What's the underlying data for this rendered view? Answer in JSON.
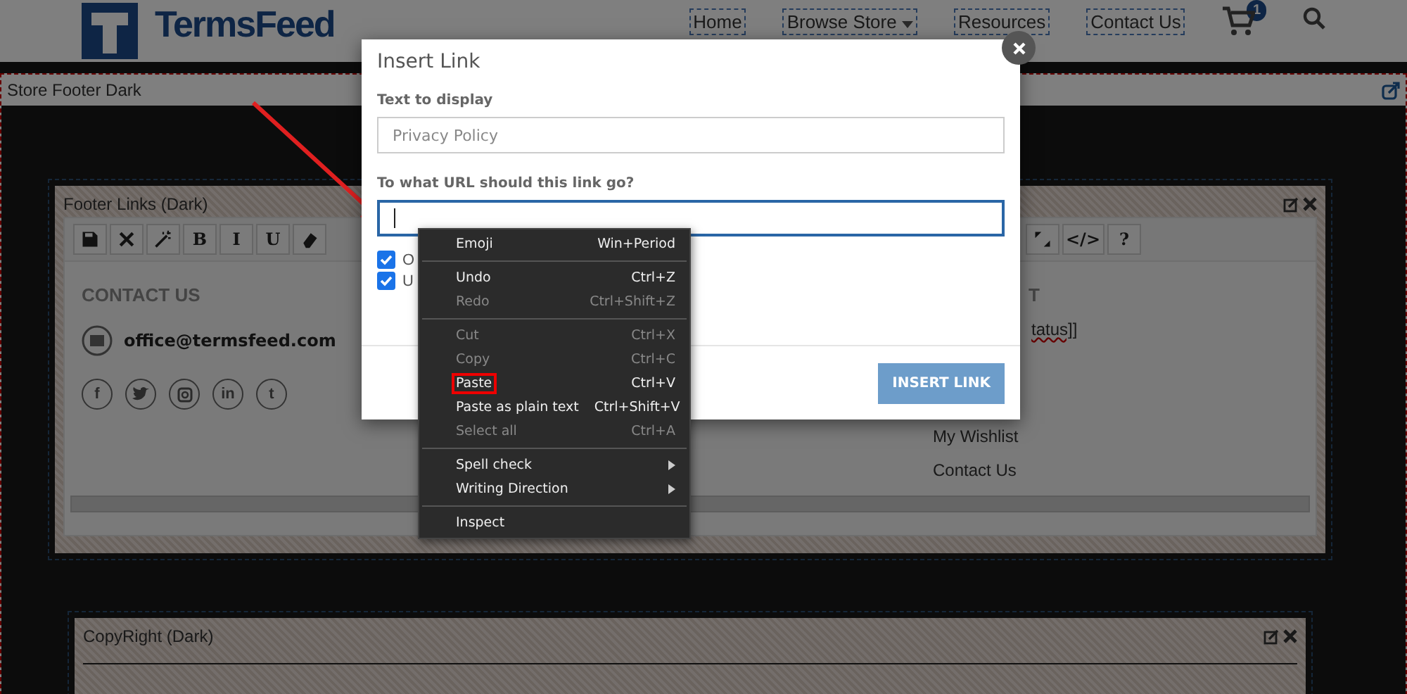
{
  "header": {
    "logo": "TermsFeed",
    "nav": [
      {
        "label": "Home",
        "dropdown": false
      },
      {
        "label": "Browse Store",
        "dropdown": true
      },
      {
        "label": "Resources",
        "dropdown": false
      },
      {
        "label": "Contact Us",
        "dropdown": false
      }
    ],
    "cart_count": "1"
  },
  "section": {
    "title": "Store Footer Dark"
  },
  "footer_links": {
    "title": "Footer Links (Dark)",
    "toolbar": [
      {
        "kind": "save"
      },
      {
        "kind": "close"
      },
      {
        "kind": "magic"
      },
      {
        "kind": "text",
        "label": "B"
      },
      {
        "kind": "text",
        "label": "I"
      },
      {
        "kind": "text",
        "label": "U"
      },
      {
        "kind": "eraser"
      }
    ],
    "toolbar_right": [
      {
        "kind": "expand"
      },
      {
        "kind": "text",
        "label": "</>"
      },
      {
        "kind": "text",
        "label": "?"
      }
    ],
    "contact_heading": "CONTACT US",
    "email": "office@termsfeed.com",
    "social": [
      {
        "kind": "letter",
        "label": "f"
      },
      {
        "kind": "twitter"
      },
      {
        "kind": "instagram"
      },
      {
        "kind": "letter",
        "label": "in"
      },
      {
        "kind": "letter",
        "label": "t"
      }
    ],
    "right_heading": "T",
    "right_links": [
      "tatus]]",
      "My Wishlist",
      "Contact Us"
    ]
  },
  "copyright": {
    "title": "CopyRight (Dark)"
  },
  "dialog": {
    "title": "Insert Link",
    "fields": [
      {
        "label": "Text to display",
        "value": "Privacy Policy",
        "focused": false
      },
      {
        "label": "To what URL should this link go?",
        "focused": true
      }
    ],
    "checkboxes": [
      {
        "label": "O",
        "checked": true
      },
      {
        "label": "U",
        "checked": true
      }
    ],
    "button": "INSERT LINK"
  },
  "context_menu": [
    {
      "kind": "item",
      "label": "Emoji",
      "shortcut": "Win+Period",
      "disabled": false,
      "submenu": false,
      "highlighted": false
    },
    {
      "kind": "separator"
    },
    {
      "kind": "item",
      "label": "Undo",
      "shortcut": "Ctrl+Z",
      "disabled": false,
      "submenu": false,
      "highlighted": false
    },
    {
      "kind": "item",
      "label": "Redo",
      "shortcut": "Ctrl+Shift+Z",
      "disabled": true,
      "submenu": false,
      "highlighted": false
    },
    {
      "kind": "separator"
    },
    {
      "kind": "item",
      "label": "Cut",
      "shortcut": "Ctrl+X",
      "disabled": true,
      "submenu": false,
      "highlighted": false
    },
    {
      "kind": "item",
      "label": "Copy",
      "shortcut": "Ctrl+C",
      "disabled": true,
      "submenu": false,
      "highlighted": false
    },
    {
      "kind": "item",
      "label": "Paste",
      "shortcut": "Ctrl+V",
      "disabled": false,
      "submenu": false,
      "highlighted": true
    },
    {
      "kind": "item",
      "label": "Paste as plain text",
      "shortcut": "Ctrl+Shift+V",
      "disabled": false,
      "submenu": false,
      "highlighted": false
    },
    {
      "kind": "item",
      "label": "Select all",
      "shortcut": "Ctrl+A",
      "disabled": true,
      "submenu": false,
      "highlighted": false
    },
    {
      "kind": "separator"
    },
    {
      "kind": "item",
      "label": "Spell check",
      "disabled": false,
      "submenu": true,
      "highlighted": false
    },
    {
      "kind": "item",
      "label": "Writing Direction",
      "disabled": false,
      "submenu": true,
      "highlighted": false
    },
    {
      "kind": "separator"
    },
    {
      "kind": "item",
      "label": "Inspect",
      "disabled": false,
      "submenu": false,
      "highlighted": false
    }
  ]
}
